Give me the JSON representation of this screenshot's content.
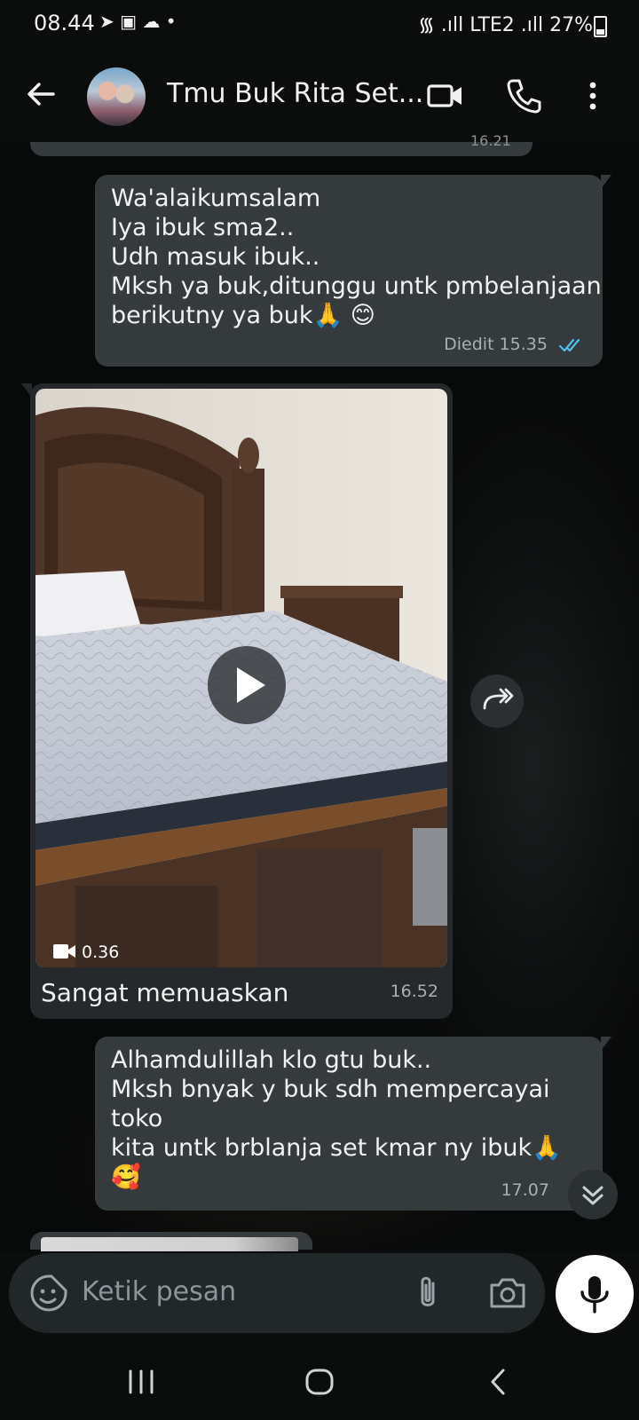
{
  "status_bar": {
    "time": "08.44",
    "left_icons": "➤ ▣ ☁ •",
    "right_text": "᯾ .ıll LTE2 .ıll 27%",
    "battery_percent": 27
  },
  "header": {
    "title": "Tmu Buk Rita Set...",
    "avatar_icon": "group-avatar"
  },
  "previous_message": {
    "time": "16.21"
  },
  "messages": [
    {
      "direction": "outgoing",
      "text": "Wa'alaikumsalam\nIya ibuk sma2..\nUdh masuk ibuk..\nMksh ya buk,ditunggu untk pmbelanjaan\nberikutny ya buk🙏 😊",
      "meta": "Diedit 15.35",
      "status": "read"
    },
    {
      "direction": "incoming",
      "type": "video",
      "duration": "0.36",
      "caption": "Sangat memuaskan",
      "time": "16.52"
    },
    {
      "direction": "outgoing",
      "text": "Alhamdulillah klo gtu buk..\nMksh bnyak y buk sdh mempercayai toko\nkita untk brblanja set kmar ny ibuk🙏\n🥰",
      "time": "17.07"
    }
  ],
  "input": {
    "placeholder": "Ketik pesan"
  },
  "colors": {
    "bubble": "#353a3d",
    "incoming_bubble": "#25292b",
    "read_ticks": "#53bdeb"
  }
}
